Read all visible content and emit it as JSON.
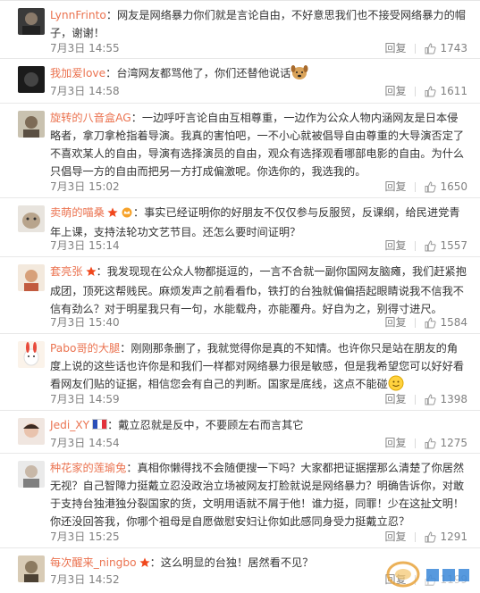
{
  "ui": {
    "reply_label": "回复",
    "accent": "#eb7350"
  },
  "comments": [
    {
      "user": "LynnFrinto",
      "badge": null,
      "sep": "：",
      "text": "网友是网络暴力你们就是言论自由，不好意思我们也不接受网络暴力的帽子，谢谢！",
      "emoji": null,
      "time": "7月3日 14:55",
      "likes": "1743"
    },
    {
      "user": "我加爱love",
      "badge": null,
      "sep": "：",
      "text": "台湾网友都骂他了，你们还替他说话",
      "emoji": "dog-emoji",
      "time": "7月3日 14:58",
      "likes": "1611"
    },
    {
      "user": "旋转的八音盒AG",
      "badge": null,
      "sep": "：",
      "text": "一边呼吁言论自由互相尊重，一边作为公众人物内涵网友是日本侵略者，拿刀拿枪指着导演。我真的害怕吧，一不小心就被倡导自由尊重的大导演否定了不喜欢某人的自由，导演有选择演员的自由，观众有选择观看哪部电影的自由。为什么只倡导一方的自由而把另一方打成偏激呢。你选你的，我选我的。",
      "emoji": null,
      "time": "7月3日 15:02",
      "likes": "1650"
    },
    {
      "user": "卖萌的喵桑",
      "badge": "star-badge",
      "sep": "：",
      "text": "事实已经证明你的好朋友不仅仅参与反服贸，反课纲，给民进党青年上课，支持法轮功文艺节目。还怎么要时间证明？",
      "emoji": null,
      "time": "7月3日 15:14",
      "likes": "1557"
    },
    {
      "user": "套亮张",
      "badge": "star-badge",
      "sep": "：",
      "text": "我发现现在公众人物都挺逗的，一言不合就一副你国网友脑瘫，我们赶紧抱成团，顶死这帮贱民。麻烦发声之前看看fb，铁打的台独就偏偏捂起眼睛说我不信我不信有劲么？对于明星我只有一句，水能载舟，亦能覆舟。好自为之，别得寸进尺。",
      "emoji": null,
      "time": "7月3日 15:40",
      "likes": "1584"
    },
    {
      "user": "Pabo哥的大腿",
      "badge": null,
      "sep": "：",
      "text": "刚刚那条删了，我就觉得你是真的不知情。也许你只是站在朋友的角度上说的这些话也许你是和我们一样都对网络暴力很是敏感，但是我希望您可以好好看看网友们贴的证据，相信您会有自己的判断。国家是底线，这点不能碰",
      "emoji": "smile-emoji",
      "time": "7月3日 14:59",
      "likes": "1398"
    },
    {
      "user": "Jedi_XY",
      "badge": "france-flag",
      "sep": "：",
      "text": "戴立忍就是反中，不要顾左右而言其它",
      "emoji": null,
      "time": "7月3日 14:54",
      "likes": "1275"
    },
    {
      "user": "种花家的莲瑜兔",
      "badge": null,
      "sep": "：",
      "text": "真相你懒得找不会随便搜一下吗？大家都把证据摆那么清楚了你居然无视？自己智障力挺戴立忍没政治立场被网友打脸就说是网络暴力？明确告诉你，对敢于支持台独港独分裂国家的货，文明用语就不屑于他！谁力挺，同罪！少在这扯文明！你还没回答我，你哪个祖母是自愿做慰安妇让你如此感同身受力挺戴立忍？",
      "emoji": null,
      "time": "7月3日 15:25",
      "likes": "1291"
    },
    {
      "user": "每次醒来_ningbo",
      "badge": "star-badge",
      "sep": "：",
      "text": "这么明显的台独！居然看不见？",
      "emoji": null,
      "time": "7月3日 14:52",
      "likes": "1199"
    }
  ]
}
